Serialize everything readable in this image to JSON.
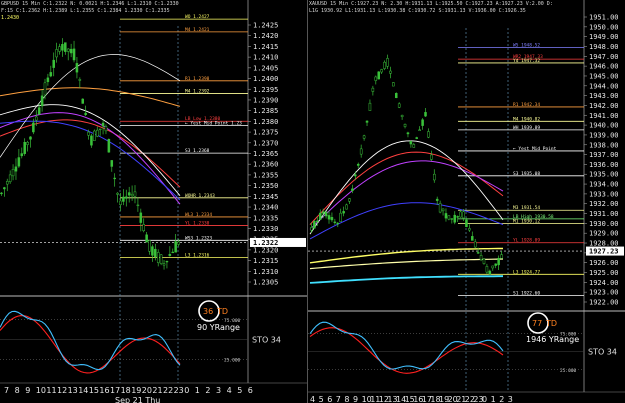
{
  "left": {
    "symbol_line": "GBPUSD 15 Min C:1.2322 N: 0.0021 H:1.2346 L:1.2310 C:1.2330",
    "sub_line": "F:15 C:1.2362 H:1.2389 L:1.2355 C:1.2384 1.2330 C:1.2335",
    "corner_value": "1.2430",
    "price_ticks": [
      "1.2425",
      "1.2420",
      "1.2415",
      "1.2410",
      "1.2405",
      "1.2400",
      "1.2395",
      "1.2390",
      "1.2385",
      "1.2380",
      "1.2375",
      "1.2370",
      "1.2365",
      "1.2360",
      "1.2355",
      "1.2350",
      "1.2345",
      "1.2340",
      "1.2335",
      "1.2330",
      "1.2325",
      "1.2320",
      "1.2315",
      "1.2310",
      "1.2305"
    ],
    "current_price": "1.2322",
    "levels": [
      {
        "label": "WO 1.2427",
        "price": 1.2427,
        "color": "#ffff66"
      },
      {
        "label": "M4 1.2421",
        "price": 1.2421,
        "color": "#ffa040"
      },
      {
        "label": "R1 1.2398",
        "price": 1.2398,
        "color": "#ffa040"
      },
      {
        "label": "M4 1.2392",
        "price": 1.2392,
        "color": "#ffff99"
      },
      {
        "label": "LB Low 1.2380",
        "price": 1.2379,
        "color": "#ff4040"
      },
      {
        "label": "← Yest Mid Point 1.23",
        "price": 1.2377,
        "color": "#ffffff"
      },
      {
        "label": "S3 1.2368",
        "price": 1.2364,
        "color": "#ffffff"
      },
      {
        "label": "WOHR 1.2343",
        "price": 1.2343,
        "color": "#ffff99"
      },
      {
        "label": "WL3 1.2334",
        "price": 1.2334,
        "color": "#ffa040"
      },
      {
        "label": "YL 1.2330",
        "price": 1.233,
        "color": "#ff4040"
      },
      {
        "label": "WS3 1.2323",
        "price": 1.2323,
        "color": "#ffffff"
      },
      {
        "label": "L3 1.2316",
        "price": 1.2315,
        "color": "#ffff66"
      }
    ],
    "td_value": "36",
    "td_label": "TD",
    "yrange": "90 YRange",
    "osc_levels": [
      "75.000",
      "25.000"
    ],
    "sto_label": "STO  34",
    "time_labels": [
      "7",
      "8",
      "9",
      "10",
      "11",
      "12",
      "13",
      "14",
      "15",
      "16",
      "17",
      "18",
      "19",
      "20",
      "21",
      "22",
      "23",
      "0",
      "1",
      "2",
      "3",
      "4",
      "5",
      "6"
    ],
    "date_label": "Sep 21 Thu"
  },
  "right": {
    "symbol_line": "XAUUSD 15 Min C:1927.23 N: 2.30 H:1931.13 L:1925.50 C:1927.23 A:1927.23 V:2.00 D:",
    "sub_line": "L1G 1930.92 L1:1931.13 L:1930.38 C:1930.72 S:1931.13 V:1936.00 C:1926.35",
    "price_ticks": [
      "1951.00",
      "1950.00",
      "1949.00",
      "1948.00",
      "1947.00",
      "1946.00",
      "1945.00",
      "1944.00",
      "1943.00",
      "1942.00",
      "1941.00",
      "1940.00",
      "1939.00",
      "1938.00",
      "1937.00",
      "1936.00",
      "1935.00",
      "1934.00",
      "1933.00",
      "1932.00",
      "1931.00",
      "1930.00",
      "1929.00",
      "1928.00",
      "1927.00",
      "1926.00",
      "1925.00",
      "1924.00",
      "1923.00",
      "1922.00"
    ],
    "current_price": "1927.23",
    "levels": [
      {
        "label": "W5 1948.52",
        "price": 1948.5,
        "color": "#8080ff"
      },
      {
        "label": "WR2 1947.33",
        "price": 1947.3,
        "color": "#ff4040"
      },
      {
        "label": "Yd 1947.32",
        "price": 1946.9,
        "color": "#ffff99"
      },
      {
        "label": "R1 1942.34",
        "price": 1942.3,
        "color": "#ffa040"
      },
      {
        "label": "M4 1940.82",
        "price": 1940.8,
        "color": "#ffff99"
      },
      {
        "label": "WH 1939.89",
        "price": 1939.9,
        "color": "#ffffff"
      },
      {
        "label": "← Yest Mid Point",
        "price": 1937.7,
        "color": "#ffffff"
      },
      {
        "label": "S3 1935.08",
        "price": 1935.1,
        "color": "#ffffff"
      },
      {
        "label": "M3 1931.54",
        "price": 1931.5,
        "color": "#ffff99"
      },
      {
        "label": "LB High 1930.58",
        "price": 1930.6,
        "color": "#80ff80"
      },
      {
        "label": "M1 1930.12",
        "price": 1930.1,
        "color": "#ffff99"
      },
      {
        "label": "YL 1928.09",
        "price": 1928.1,
        "color": "#ff4040"
      },
      {
        "label": "L3 1924.77",
        "price": 1924.8,
        "color": "#ffff66"
      },
      {
        "label": "S1 1922.60",
        "price": 1922.6,
        "color": "#ffffff"
      }
    ],
    "td_value": "77",
    "td_label": "TD",
    "yrange": "1946 YRange",
    "osc_levels": [
      "75.000",
      "25.000"
    ],
    "sto_label": "STO  34",
    "time_labels": [
      "4",
      "5",
      "6",
      "7",
      "8",
      "9",
      "10",
      "11",
      "12",
      "13",
      "14",
      "15",
      "16",
      "17",
      "18",
      "19",
      "20",
      "21",
      "22",
      "23",
      "0",
      "1",
      "2",
      "3"
    ],
    "date_label": "Sep 21 Thu"
  }
}
